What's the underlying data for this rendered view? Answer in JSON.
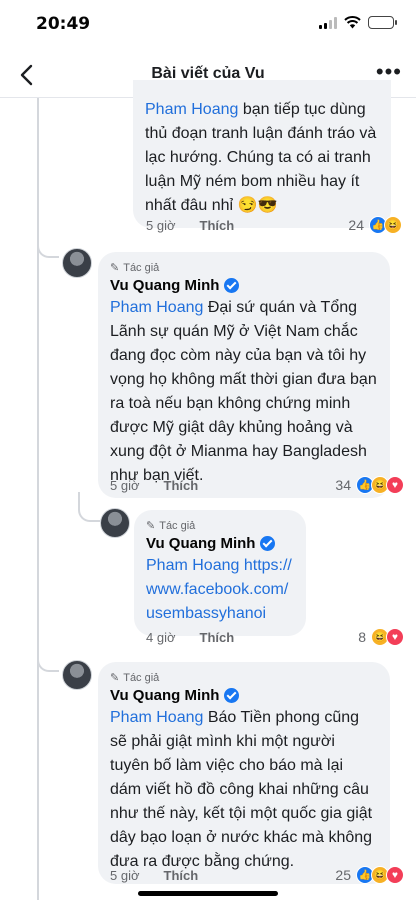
{
  "status": {
    "time": "20:49"
  },
  "header": {
    "title": "Bài viết của Vu"
  },
  "comments": [
    {
      "mention": "Pham Hoang",
      "text": " bạn tiếp tục dùng thủ đoạn tranh luận đánh tráo và lạc hướng. Chúng ta có ai tranh luận Mỹ ném bom nhiều hay ít nhất đâu nhỉ 😏😎",
      "time": "5 giờ",
      "like": "Thích",
      "reaction_count": "24"
    },
    {
      "badge": "Tác giả",
      "name": "Vu Quang Minh",
      "mention": "Pham Hoang",
      "text": " Đại sứ quán và Tổng Lãnh sự quán Mỹ ở Việt Nam chắc đang đọc còm này của bạn và tôi hy vọng họ không mất thời gian đưa bạn ra toà nếu bạn không chứng minh được Mỹ giật dây khủng hoảng và xung đột ở Mianma hay Bangladesh như bạn viết.",
      "time": "5 giờ",
      "like": "Thích",
      "reaction_count": "34"
    },
    {
      "badge": "Tác giả",
      "name": "Vu Quang Minh",
      "mention": "Pham Hoang",
      "link": "https://www.facebook.com/usembassyhanoi",
      "time": "4 giờ",
      "like": "Thích",
      "reaction_count": "8"
    },
    {
      "badge": "Tác giả",
      "name": "Vu Quang Minh",
      "mention": "Pham Hoang",
      "text": " Báo Tiền phong cũng sẽ phải giật mình khi một người tuyên bố làm việc cho báo mà lại dám viết hồ đồ công khai những câu như thế này, kết tội một quốc gia giật dây bạo loạn ở nước khác mà không đưa ra được bằng chứng.",
      "time": "5 giờ",
      "like": "Thích",
      "reaction_count": "25"
    }
  ]
}
